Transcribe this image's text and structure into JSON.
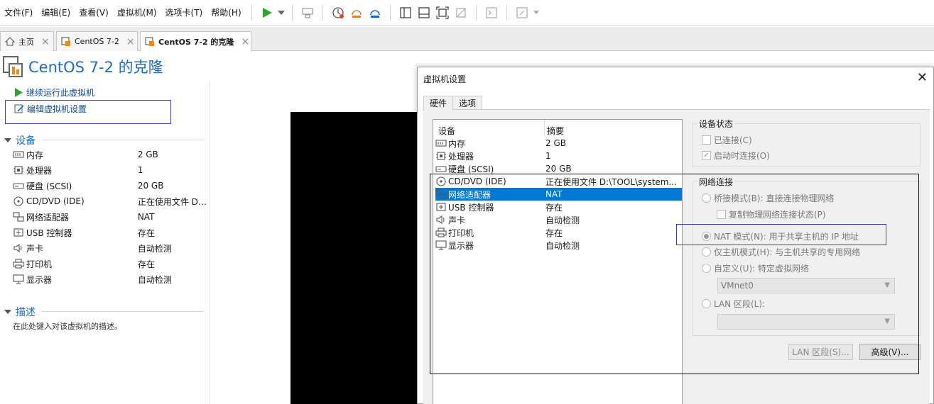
{
  "menu": [
    "文件(F)",
    "编辑(E)",
    "查看(V)",
    "虚拟机(M)",
    "选项卡(T)",
    "帮助(H)"
  ],
  "toolbar_icons": [
    "play-icon",
    "dropdown-arrow-icon",
    "send-keys-icon",
    "snapshot-icon",
    "revert-snapshot-icon",
    "snapshot-manager-icon",
    "library-panel-icon",
    "console-view-icon",
    "fullscreen-icon",
    "unity-icon",
    "terminal-icon",
    "stretch-icon"
  ],
  "tabs": [
    {
      "label": "主页",
      "icon": "home-icon"
    },
    {
      "label": "CentOS 7-2",
      "icon": "vm-icon"
    },
    {
      "label": "CentOS 7-2 的克隆",
      "icon": "vm-icon"
    }
  ],
  "vm": {
    "title": "CentOS 7-2 的克隆",
    "actions": [
      "继续运行此虚拟机",
      "编辑虚拟机设置"
    ]
  },
  "devices_section": "设备",
  "devices": [
    {
      "name": "内存",
      "value": "2 GB",
      "icon": "memory-icon"
    },
    {
      "name": "处理器",
      "value": "1",
      "icon": "cpu-icon"
    },
    {
      "name": "硬盘 (SCSI)",
      "value": "20 GB",
      "icon": "harddisk-icon"
    },
    {
      "name": "CD/DVD (IDE)",
      "value": "正在使用文件 D:...",
      "icon": "cd-icon"
    },
    {
      "name": "网络适配器",
      "value": "NAT",
      "icon": "network-icon"
    },
    {
      "name": "USB 控制器",
      "value": "存在",
      "icon": "usb-icon"
    },
    {
      "name": "声卡",
      "value": "自动检测",
      "icon": "sound-icon"
    },
    {
      "name": "打印机",
      "value": "存在",
      "icon": "printer-icon"
    },
    {
      "name": "显示器",
      "value": "自动检测",
      "icon": "display-icon"
    }
  ],
  "description_section": "描述",
  "description_placeholder": "在此处键入对该虚拟机的描述。",
  "dialog": {
    "title": "虚拟机设置",
    "tabs": [
      "硬件",
      "选项"
    ],
    "list_headers": [
      "设备",
      "摘要"
    ],
    "devices": [
      {
        "name": "内存",
        "value": "2 GB"
      },
      {
        "name": "处理器",
        "value": "1"
      },
      {
        "name": "硬盘 (SCSI)",
        "value": "20 GB"
      },
      {
        "name": "CD/DVD (IDE)",
        "value": "正在使用文件 D:\\TOOL\\system..."
      },
      {
        "name": "网络适配器",
        "value": "NAT"
      },
      {
        "name": "USB 控制器",
        "value": "存在"
      },
      {
        "name": "声卡",
        "value": "自动检测"
      },
      {
        "name": "打印机",
        "value": "存在"
      },
      {
        "name": "显示器",
        "value": "自动检测"
      }
    ],
    "device_status": {
      "label": "设备状态",
      "connected": "已连接(C)",
      "connect_on_power": "启动时连接(O)"
    },
    "network": {
      "label": "网络连接",
      "bridged": "桥接模式(B): 直接连接物理网络",
      "replicate": "复制物理网络连接状态(P)",
      "nat": "NAT 模式(N): 用于共享主机的 IP 地址",
      "host_only": "仅主机模式(H): 与主机共享的专用网络",
      "custom": "自定义(U): 特定虚拟网络",
      "vmnet_value": "VMnet0",
      "lan_segment": "LAN 区段(L):",
      "lan_button": "LAN 区段(S)...",
      "advanced_button": "高级(V)..."
    }
  }
}
